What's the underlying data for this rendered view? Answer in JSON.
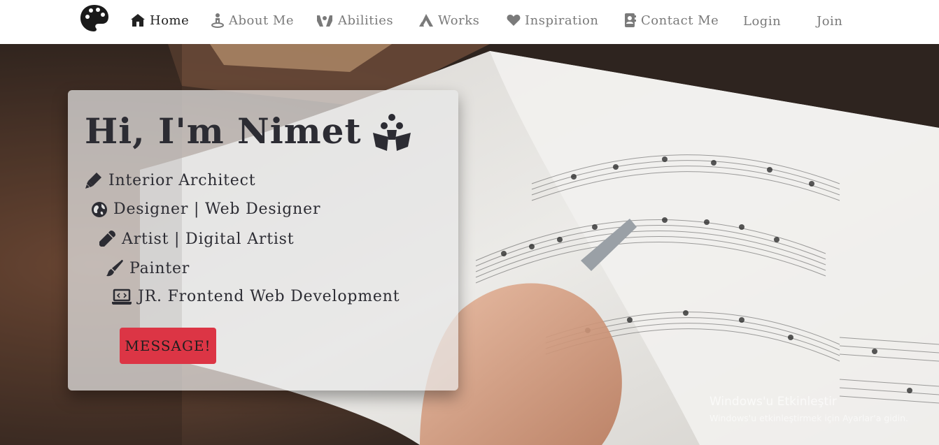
{
  "navbar": {
    "items": [
      {
        "label": "Home",
        "icon": "house-icon"
      },
      {
        "label": "About Me",
        "icon": "person-icon"
      },
      {
        "label": "Abilities",
        "icon": "hands-icon"
      },
      {
        "label": "Works",
        "icon": "triangle-logo-icon"
      },
      {
        "label": "Inspiration",
        "icon": "heart-icon"
      },
      {
        "label": "Contact Me",
        "icon": "address-book-icon"
      }
    ],
    "login_label": "Login",
    "join_label": "Join"
  },
  "hero": {
    "headline": "Hi, I'm Nimet",
    "roles": [
      {
        "text": "Interior Architect",
        "icon": "highlighter-icon"
      },
      {
        "text": "Designer | Web Designer",
        "icon": "globe-icon"
      },
      {
        "text": "Artist | Digital Artist",
        "icon": "eyedropper-icon"
      },
      {
        "text": "Painter",
        "icon": "paintbrush-icon"
      },
      {
        "text": "JR. Frontend Web Development",
        "icon": "laptop-code-icon"
      }
    ],
    "message_button": "MESSAGE!"
  },
  "watermark": {
    "title": "Windows'u Etkinleştir",
    "subtitle": "Windows'u etkinleştirmek için Ayarlar'a gidin."
  },
  "colors": {
    "accent": "#dc3545",
    "navbar_bg": "#ffffff",
    "text_dark": "#2c2c33",
    "nav_inactive": "#7a7a7a"
  }
}
